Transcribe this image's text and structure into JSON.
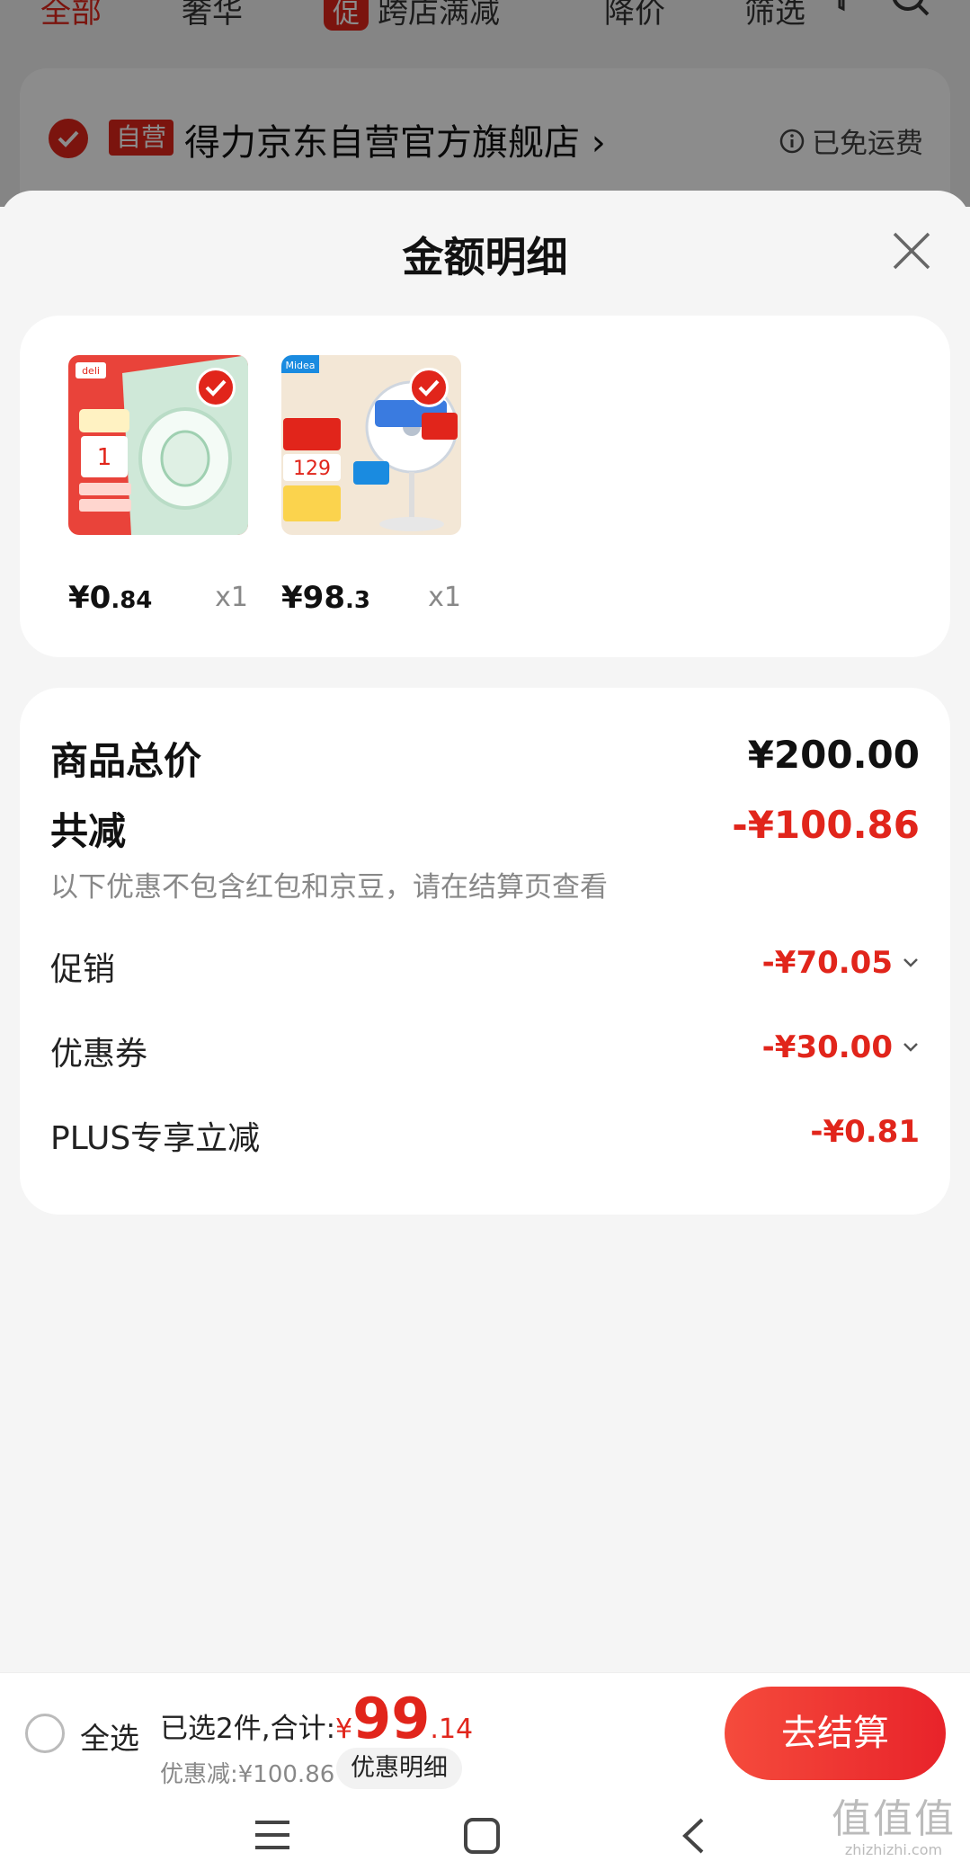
{
  "background": {
    "tabs": {
      "all": "全部",
      "luxury": "奢华",
      "promo_tag": "促",
      "cross_store": "跨店满减",
      "price_drop": "降价",
      "filter": "筛选"
    },
    "store": {
      "tag": "自营",
      "name": "得力京东自营官方旗舰店",
      "shipping": "已免运费"
    }
  },
  "sheet": {
    "title": "金额明细",
    "products": [
      {
        "price_int": "¥0",
        "price_dec": ".84",
        "qty": "x1",
        "thumb_brand": "deli"
      },
      {
        "price_int": "¥98",
        "price_dec": ".3",
        "qty": "x1",
        "thumb_brand": "Midea"
      }
    ],
    "summary": {
      "total_label": "商品总价",
      "total_value": "¥200.00",
      "reduce_label": "共减",
      "reduce_value": "-¥100.86",
      "note": "以下优惠不包含红包和京豆，请在结算页查看",
      "promo_label": "促销",
      "promo_value": "-¥70.05",
      "coupon_label": "优惠券",
      "coupon_value": "-¥30.00",
      "plus_label": "PLUS专享立减",
      "plus_value": "-¥0.81"
    }
  },
  "bottom_bar": {
    "select_all": "全选",
    "selected_text": "已选2件,合计:",
    "currency": "¥",
    "total_int": "99",
    "total_dec": ".14",
    "discount_text": "优惠减:¥100.86",
    "detail_chip": "优惠明细",
    "checkout": "去结算"
  },
  "watermark": {
    "big": "值值值",
    "small": "zhizhizhi.com"
  },
  "colors": {
    "accent": "#e1251b",
    "checkout_gradient_start": "#f54b3c"
  }
}
